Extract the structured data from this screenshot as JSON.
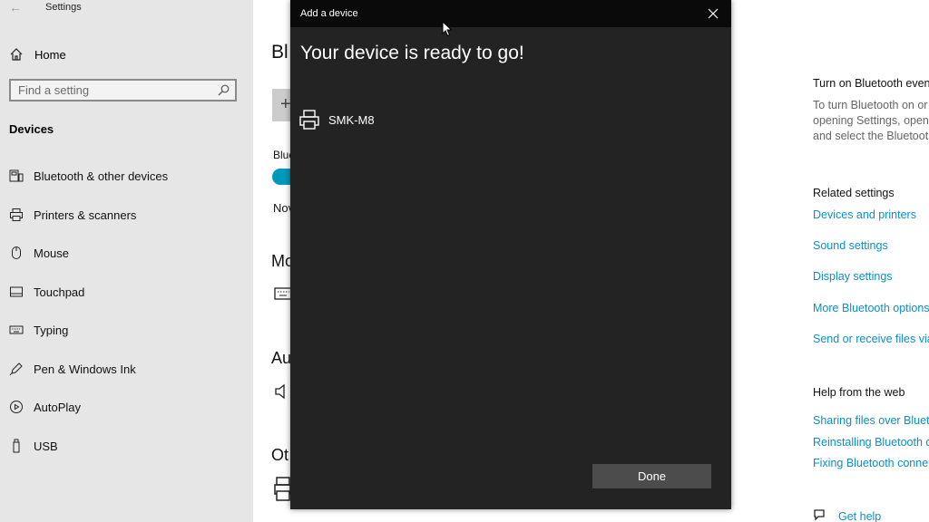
{
  "window": {
    "title": "Settings",
    "back_glyph": "←"
  },
  "sidebar": {
    "home_label": "Home",
    "search_placeholder": "Find a setting",
    "section_title": "Devices",
    "items": [
      {
        "label": "Bluetooth & other devices",
        "icon": "bluetooth-devices-icon"
      },
      {
        "label": "Printers & scanners",
        "icon": "printer-icon"
      },
      {
        "label": "Mouse",
        "icon": "mouse-icon"
      },
      {
        "label": "Touchpad",
        "icon": "touchpad-icon"
      },
      {
        "label": "Typing",
        "icon": "keyboard-icon"
      },
      {
        "label": "Pen & Windows Ink",
        "icon": "pen-icon"
      },
      {
        "label": "AutoPlay",
        "icon": "autoplay-icon"
      },
      {
        "label": "USB",
        "icon": "usb-icon"
      }
    ]
  },
  "main_fragments": {
    "page_title": "Bl",
    "add_glyph": "+",
    "bluetooth_label": "Blue",
    "now_text": "Nov",
    "mouse_heading": "Mo",
    "audio_heading": "Au",
    "other_heading": "Ot"
  },
  "right_panel": {
    "turn_on_heading": "Turn on Bluetooth even",
    "turn_on_text": [
      "To turn Bluetooth on or",
      "opening Settings, open",
      "and select the Bluetoot"
    ],
    "related_heading": "Related settings",
    "related_links": [
      "Devices and printers",
      "Sound settings",
      "Display settings",
      "More Bluetooth options",
      "Send or receive files via"
    ],
    "help_heading": "Help from the web",
    "help_links": [
      "Sharing files over Bluet",
      "Reinstalling Bluetooth d",
      "Fixing Bluetooth conne"
    ],
    "get_help": "Get help"
  },
  "dialog": {
    "title": "Add a device",
    "heading": "Your device is ready to go!",
    "device_name": "SMK-M8",
    "device_icon": "printer-icon",
    "done_label": "Done"
  }
}
